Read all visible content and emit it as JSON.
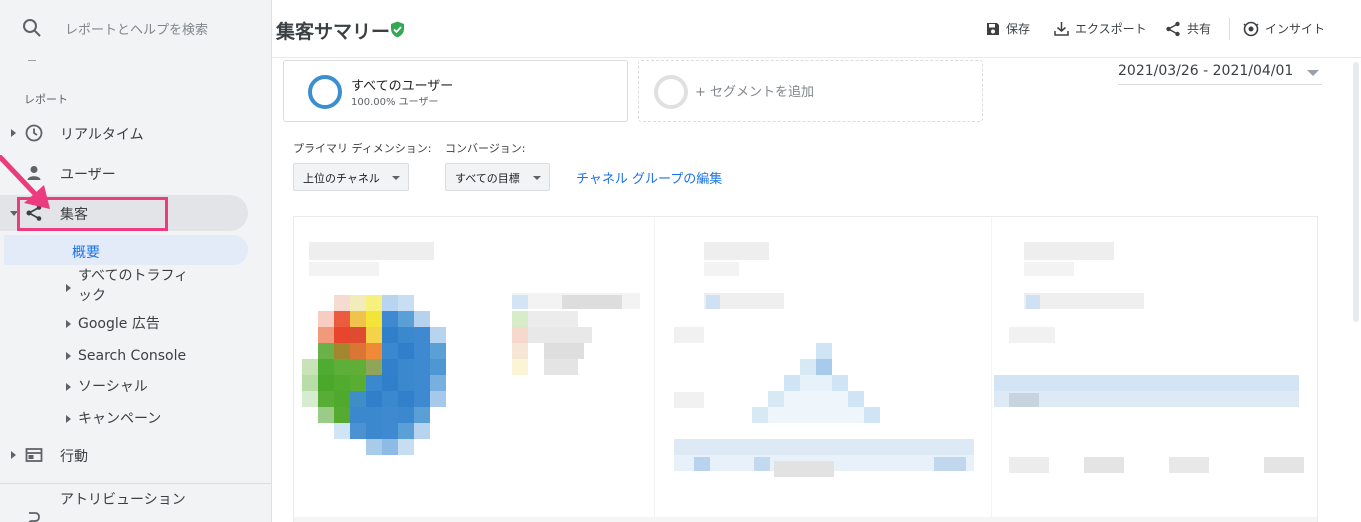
{
  "search": {
    "placeholder": "レポートとヘルプを検索",
    "icon": "search-icon"
  },
  "sidebar": {
    "section_label": "レポート",
    "items": [
      {
        "label": "リアルタイム",
        "icon": "clock-icon"
      },
      {
        "label": "ユーザー",
        "icon": "person-icon"
      },
      {
        "label": "集客",
        "icon": "acquisition-icon"
      },
      {
        "label": "行動",
        "icon": "behavior-icon"
      },
      {
        "label": "アトリビューション",
        "icon": "attribution-icon"
      }
    ],
    "acquisition_children": {
      "overview": "概要",
      "all_traffic": "すべてのトラフィック",
      "google_ads": "Google 広告",
      "search_console": "Search Console",
      "social": "ソーシャル",
      "campaigns": "キャンペーン"
    }
  },
  "header": {
    "title": "集客サマリー",
    "tools": {
      "save": "保存",
      "export": "エクスポート",
      "share": "共有",
      "insights": "インサイト"
    }
  },
  "segments": {
    "active_name": "すべてのユーザー",
    "active_sub": "100.00% ユーザー",
    "add_label": "+ セグメントを追加"
  },
  "date_range": "2021/03/26 - 2021/04/01",
  "dimensions": {
    "primary_label": "プライマリ ディメンション:",
    "primary_value": "上位のチャネル",
    "conversion_label": "コンバージョン:",
    "conversion_value": "すべての目標",
    "edit_link": "チャネル グループの編集"
  },
  "colors": {
    "accent": "#1a73e8",
    "highlight": "#ec3c7d",
    "verified": "#34a853"
  }
}
